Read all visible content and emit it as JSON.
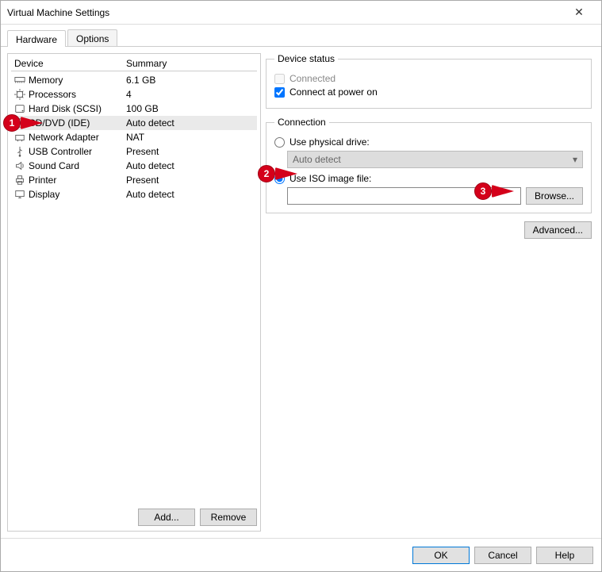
{
  "window": {
    "title": "Virtual Machine Settings",
    "close_glyph": "✕"
  },
  "tabs": {
    "hardware": "Hardware",
    "options": "Options"
  },
  "device_table": {
    "header_device": "Device",
    "header_summary": "Summary",
    "rows": [
      {
        "name": "Memory",
        "summary": "6.1 GB",
        "icon": "memory-icon"
      },
      {
        "name": "Processors",
        "summary": "4",
        "icon": "cpu-icon"
      },
      {
        "name": "Hard Disk (SCSI)",
        "summary": "100 GB",
        "icon": "hdd-icon"
      },
      {
        "name": "CD/DVD (IDE)",
        "summary": "Auto detect",
        "icon": "disc-icon",
        "selected": true
      },
      {
        "name": "Network Adapter",
        "summary": "NAT",
        "icon": "nic-icon"
      },
      {
        "name": "USB Controller",
        "summary": "Present",
        "icon": "usb-icon"
      },
      {
        "name": "Sound Card",
        "summary": "Auto detect",
        "icon": "sound-icon"
      },
      {
        "name": "Printer",
        "summary": "Present",
        "icon": "printer-icon"
      },
      {
        "name": "Display",
        "summary": "Auto detect",
        "icon": "display-icon"
      }
    ]
  },
  "buttons": {
    "add": "Add...",
    "remove": "Remove",
    "browse": "Browse...",
    "advanced": "Advanced...",
    "ok": "OK",
    "cancel": "Cancel",
    "help": "Help"
  },
  "device_status": {
    "legend": "Device status",
    "connected": "Connected",
    "connect_power_on": "Connect at power on",
    "connected_checked": false,
    "connect_power_on_checked": true
  },
  "connection": {
    "legend": "Connection",
    "use_physical": "Use physical drive:",
    "physical_value": "Auto detect",
    "use_iso": "Use ISO image file:",
    "iso_value": "",
    "selected": "iso"
  },
  "annotations": {
    "c1": "1",
    "c2": "2",
    "c3": "3"
  }
}
